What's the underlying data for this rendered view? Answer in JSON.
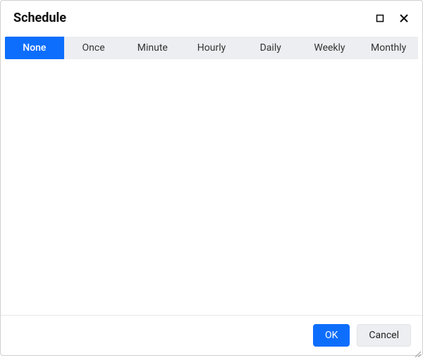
{
  "dialog": {
    "title": "Schedule"
  },
  "tabs": {
    "items": [
      {
        "label": "None",
        "active": true
      },
      {
        "label": "Once",
        "active": false
      },
      {
        "label": "Minute",
        "active": false
      },
      {
        "label": "Hourly",
        "active": false
      },
      {
        "label": "Daily",
        "active": false
      },
      {
        "label": "Weekly",
        "active": false
      },
      {
        "label": "Monthly",
        "active": false
      }
    ]
  },
  "footer": {
    "ok_label": "OK",
    "cancel_label": "Cancel"
  },
  "colors": {
    "accent": "#0d6efd",
    "tab_bg": "#eceef1"
  }
}
